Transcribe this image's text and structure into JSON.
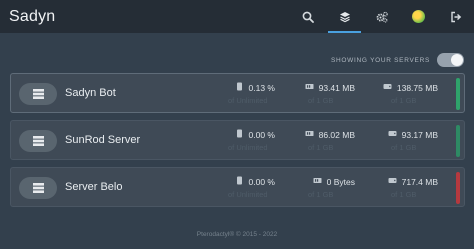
{
  "app": {
    "title": "Sadyn"
  },
  "nav": {
    "items": [
      {
        "name": "search-icon"
      },
      {
        "name": "layers-icon",
        "active": true
      },
      {
        "name": "cogs-icon"
      },
      {
        "name": "avatar"
      },
      {
        "name": "logout-icon"
      }
    ]
  },
  "toggle": {
    "label": "SHOWING YOUR SERVERS",
    "on": true
  },
  "servers": [
    {
      "name": "Sadyn Bot",
      "cpu": "0.13 %",
      "cpu_limit": "of Unlimited",
      "memory": "93.41 MB",
      "memory_limit": "of 1 GB",
      "disk": "138.75 MB",
      "disk_limit": "of 1 GB",
      "status_color": "#2fa36b"
    },
    {
      "name": "SunRod Server",
      "cpu": "0.00 %",
      "cpu_limit": "of Unlimited",
      "memory": "86.02 MB",
      "memory_limit": "of 1 GB",
      "disk": "93.17 MB",
      "disk_limit": "of 1 GB",
      "status_color": "#2e8a64"
    },
    {
      "name": "Server Belo",
      "cpu": "0.00 %",
      "cpu_limit": "of Unlimited",
      "memory": "0 Bytes",
      "memory_limit": "of 1 GB",
      "disk": "717.4 MB",
      "disk_limit": "of 1 GB",
      "status_color": "#b5393f"
    }
  ],
  "footer": {
    "text": "Pterodactyl® © 2015 - 2022"
  }
}
